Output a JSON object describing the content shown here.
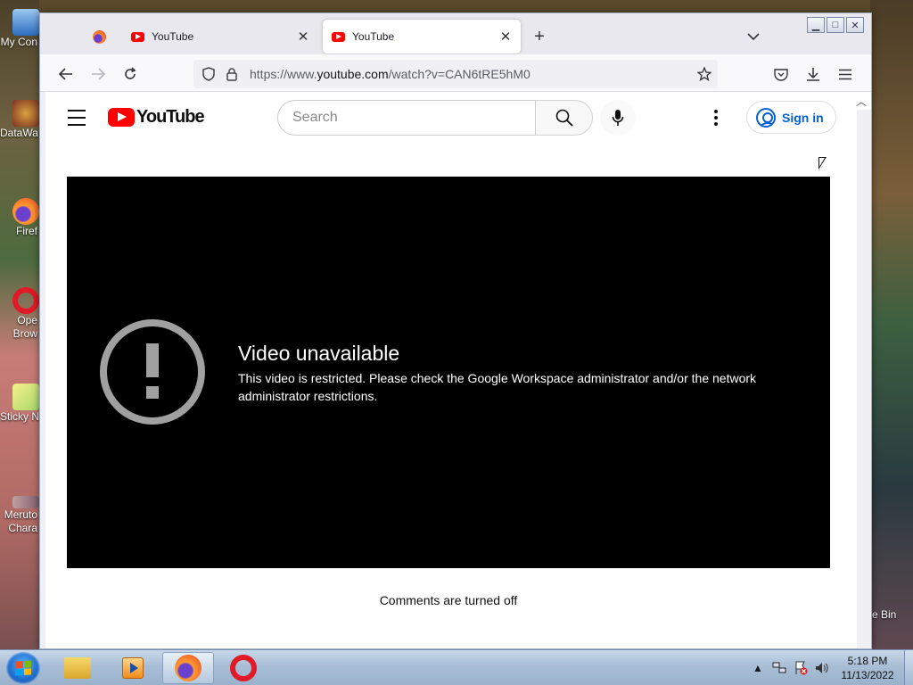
{
  "desktop": {
    "icons": [
      {
        "label": "My Con"
      },
      {
        "label": "DataWa"
      },
      {
        "label": "Firef"
      },
      {
        "label": "Ope\nBrow"
      },
      {
        "label": "Sticky N"
      },
      {
        "label": "Meruto\nChara"
      }
    ],
    "recycle_label": "e Bin"
  },
  "browser": {
    "tabs": [
      {
        "title": "YouTube",
        "favicon": "youtube-icon"
      },
      {
        "title": "YouTube",
        "favicon": "youtube-icon",
        "active": true
      }
    ],
    "url_prefix": "https://www.",
    "url_domain": "youtube.com",
    "url_path": "/watch?v=CAN6tRE5hM0"
  },
  "youtube": {
    "logo_text": "YouTube",
    "search_placeholder": "Search",
    "signin_label": "Sign in",
    "error_title": "Video unavailable",
    "error_message": "This video is restricted. Please check the Google Workspace administrator and/or the network administrator restrictions.",
    "comments_status": "Comments are turned off"
  },
  "taskbar": {
    "clock_time": "5:18 PM",
    "clock_date": "11/13/2022"
  },
  "colors": {
    "youtube_red": "#ff0000",
    "signin_blue": "#065fd4"
  }
}
